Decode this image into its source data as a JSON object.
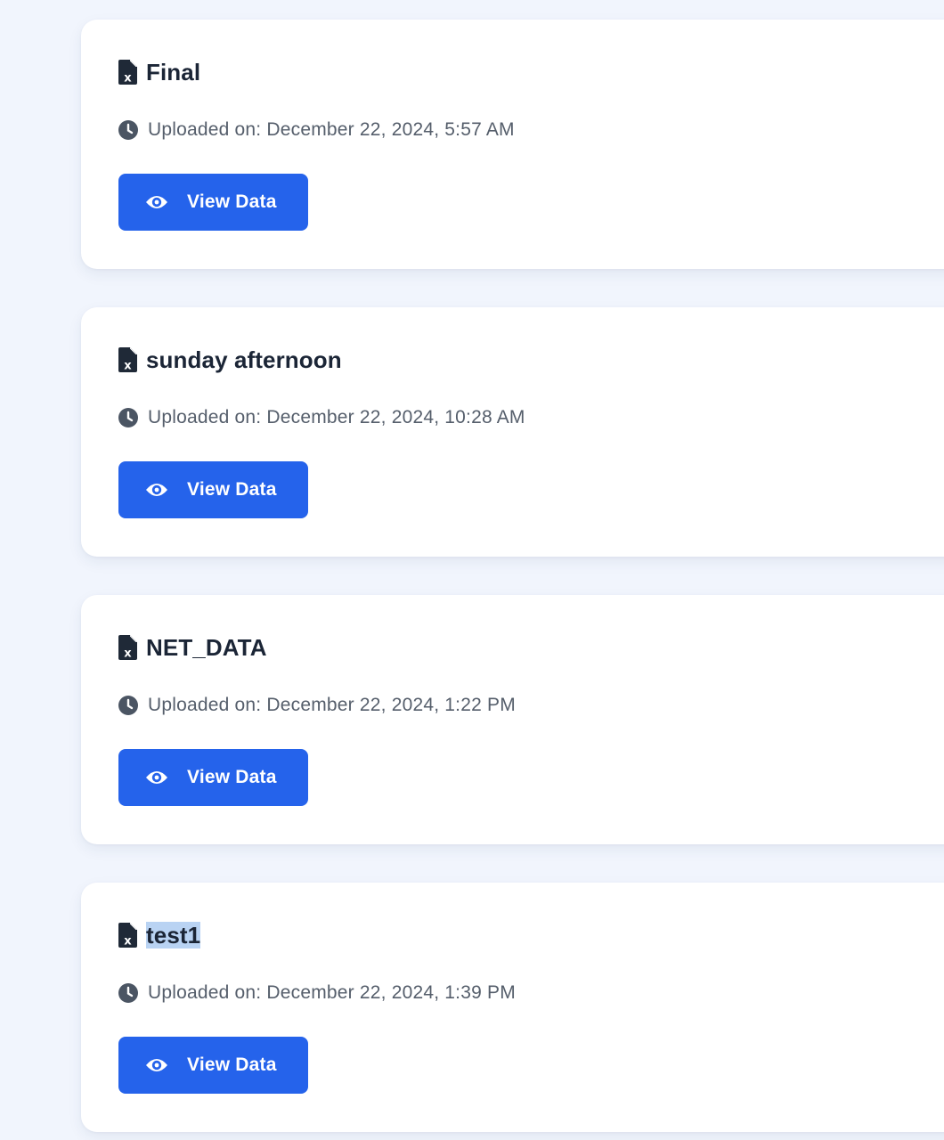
{
  "files": [
    {
      "name": "Final",
      "uploaded": "Uploaded on: December 22, 2024, 5:57 AM",
      "button_label": "View Data",
      "file_icon": "file-excel-icon",
      "clock_icon": "clock-icon",
      "button_icon": "eye-icon"
    },
    {
      "name": "sunday afternoon",
      "uploaded": "Uploaded on: December 22, 2024, 10:28 AM",
      "button_label": "View Data",
      "file_icon": "file-excel-icon",
      "clock_icon": "clock-icon",
      "button_icon": "eye-icon"
    },
    {
      "name": "NET_DATA",
      "uploaded": "Uploaded on: December 22, 2024, 1:22 PM",
      "button_label": "View Data",
      "file_icon": "file-excel-icon",
      "clock_icon": "clock-icon",
      "button_icon": "eye-icon"
    },
    {
      "name": "test1",
      "uploaded": "Uploaded on: December 22, 2024, 1:39 PM",
      "button_label": "View Data",
      "file_icon": "file-excel-icon",
      "clock_icon": "clock-icon",
      "button_icon": "eye-icon",
      "name_selected": true
    }
  ],
  "colors": {
    "page_background": "#f1f5fd",
    "card_background": "#ffffff",
    "button_primary": "#2563eb",
    "title_text": "#1b2536",
    "meta_text": "#555e6b",
    "icon_dark": "#1f2937",
    "text_selection": "#b9d3f3"
  }
}
